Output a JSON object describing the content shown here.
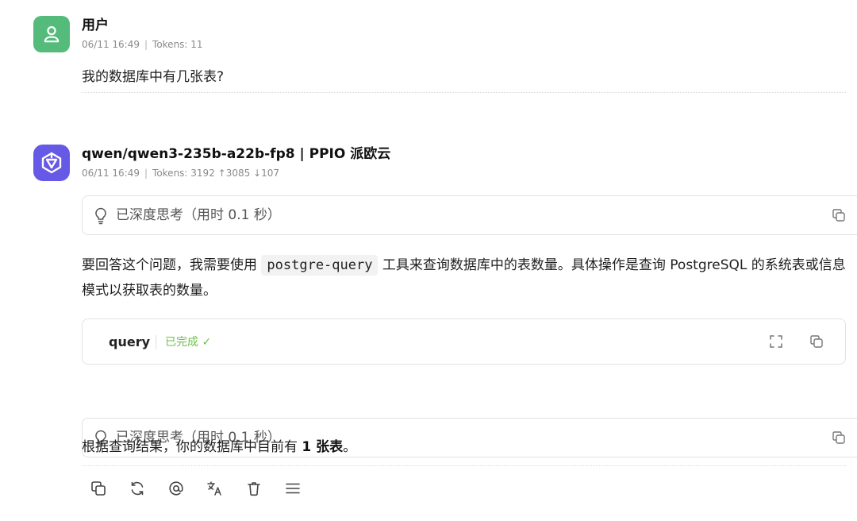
{
  "user_message": {
    "name": "用户",
    "date": "06/11 16:49",
    "tokens": "Tokens: 11",
    "text": "我的数据库中有几张表?"
  },
  "assistant_message": {
    "name": "qwen/qwen3-235b-a22b-fp8 | PPIO 派欧云",
    "date": "06/11 16:49",
    "tokens": "Tokens: 3192",
    "tokens_up": "↑3085",
    "tokens_down": "↓107",
    "thinking_1": "已深度思考（用时 0.1 秒）",
    "answer_1_before": "要回答这个问题，我需要使用 ",
    "answer_1_code": "postgre-query",
    "answer_1_after": " 工具来查询数据库中的表数量。具体操作是查询 PostgreSQL 的系统表或信息模式以获取表的数量。",
    "tool_name": "query",
    "tool_status": "已完成 ✓",
    "thinking_2": "已深度思考（用时 0.1 秒）",
    "answer_2_before": "根据查询结果，你的数据库中目前有 ",
    "answer_2_bold": "1 张表",
    "answer_2_after": "。"
  },
  "icons": {
    "user_avatar": "user-icon",
    "ai_avatar": "qwen-logo-icon",
    "think": "lightbulb-icon",
    "copy": "copy-icon",
    "chevron": "chevron-right-icon",
    "expand": "expand-icon",
    "actions": [
      "copy-icon",
      "refresh-icon",
      "mention-icon",
      "translate-icon",
      "trash-icon",
      "menu-icon"
    ]
  },
  "colors": {
    "user_avatar": "#55bb7b",
    "ai_avatar": "#6659e6",
    "status_done": "#6cc04a"
  }
}
